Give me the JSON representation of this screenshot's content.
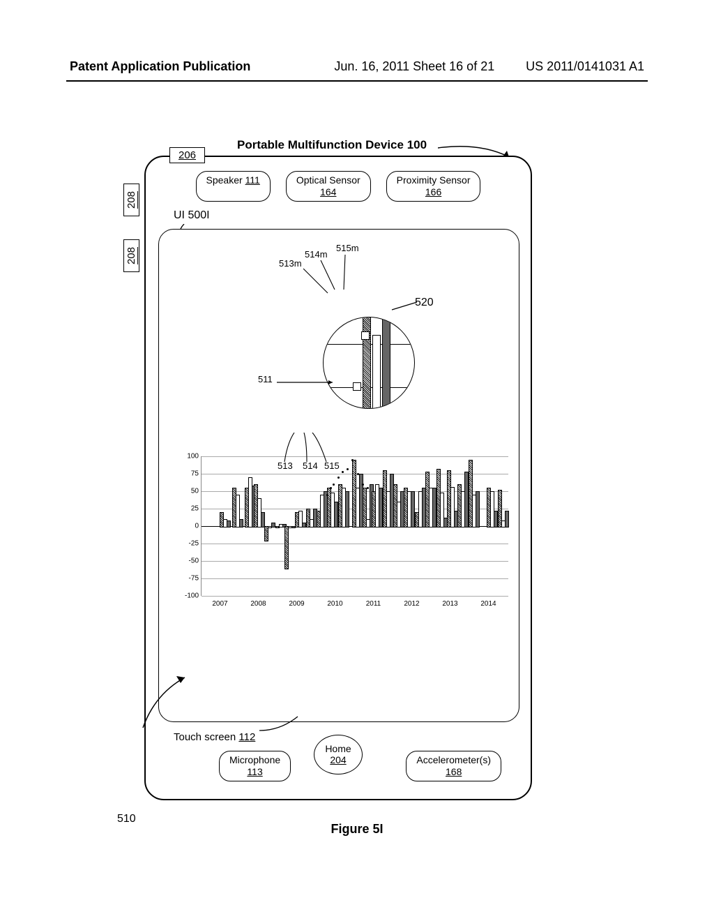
{
  "header": {
    "left": "Patent Application Publication",
    "middle": "Jun. 16, 2011  Sheet 16 of 21",
    "right": "US 2011/0141031 A1"
  },
  "device": {
    "title": "Portable Multifunction Device 100",
    "ref206": "206",
    "ref208a": "208",
    "ref208b": "208",
    "ui_label": "UI 500I",
    "sensors": {
      "speaker": {
        "label": "Speaker",
        "ref": "111"
      },
      "optical": {
        "label": "Optical Sensor",
        "ref": "164"
      },
      "proximity": {
        "label": "Proximity Sensor",
        "ref": "166"
      }
    },
    "bottom": {
      "touch": {
        "label": "Touch screen",
        "ref": "112"
      },
      "home": {
        "label": "Home",
        "ref": "204"
      },
      "mic": {
        "label": "Microphone",
        "ref": "113"
      },
      "accel": {
        "label": "Accelerometer(s)",
        "ref": "168"
      }
    }
  },
  "refs": {
    "r510": "510",
    "r520": "520",
    "r511": "511",
    "r513": "513",
    "r514": "514",
    "r515": "515",
    "r513m": "513m",
    "r514m": "514m",
    "r515m": "515m"
  },
  "figure": "Figure 5I",
  "chart_data": {
    "type": "bar",
    "ylim": [
      -100,
      100
    ],
    "y_ticks": [
      -100,
      -75,
      -50,
      -25,
      0,
      25,
      50,
      75,
      100
    ],
    "x_ticks": [
      "2007",
      "2008",
      "2009",
      "2010",
      "2011",
      "2012",
      "2013",
      "2014"
    ],
    "note": "Multi-series (3) grouped bar chart with a dotted line scatter overlay (511) and a magnified lens (520). Values are estimated from gridlines.",
    "series": [
      {
        "name": "513",
        "values_by_year_quarter": "approx 20–95 positive, a few negative down to ≈ -60 in 2008"
      },
      {
        "name": "514",
        "values_by_year_quarter": "approx 0–80, mostly positive"
      },
      {
        "name": "515",
        "values_by_year_quarter": "approx 5–85, all positive"
      }
    ],
    "bars": [
      {
        "x": 0.06,
        "s1": 20,
        "s2": 10,
        "s3": 8
      },
      {
        "x": 0.1,
        "s1": 55,
        "s2": 45,
        "s3": 10
      },
      {
        "x": 0.14,
        "s1": 55,
        "s2": 70,
        "s3": 58
      },
      {
        "x": 0.17,
        "s1": 60,
        "s2": 40,
        "s3": 20
      },
      {
        "x": 0.205,
        "s1": -20,
        "s2": 0,
        "s3": 5
      },
      {
        "x": 0.24,
        "s1": 0,
        "s2": 3,
        "s3": 3
      },
      {
        "x": 0.27,
        "s1": -60,
        "s2": 0,
        "s3": 0
      },
      {
        "x": 0.305,
        "s1": 20,
        "s2": 22,
        "s3": 5
      },
      {
        "x": 0.34,
        "s1": 25,
        "s2": 10,
        "s3": 25
      },
      {
        "x": 0.375,
        "s1": 22,
        "s2": 45,
        "s3": 50
      },
      {
        "x": 0.41,
        "s1": 55,
        "s2": 48,
        "s3": 35
      },
      {
        "x": 0.445,
        "s1": 60,
        "s2": 55,
        "s3": 50
      },
      {
        "x": 0.49,
        "s1": 95,
        "s2": 55,
        "s3": 75
      },
      {
        "x": 0.525,
        "s1": 55,
        "s2": 10,
        "s3": 60
      },
      {
        "x": 0.555,
        "s1": 50,
        "s2": 60,
        "s3": 55
      },
      {
        "x": 0.59,
        "s1": 80,
        "s2": 50,
        "s3": 75
      },
      {
        "x": 0.625,
        "s1": 60,
        "s2": 35,
        "s3": 50
      },
      {
        "x": 0.66,
        "s1": 55,
        "s2": 50,
        "s3": 50
      },
      {
        "x": 0.695,
        "s1": 20,
        "s2": 50,
        "s3": 55
      },
      {
        "x": 0.73,
        "s1": 78,
        "s2": 55,
        "s3": 55
      },
      {
        "x": 0.765,
        "s1": 82,
        "s2": 48,
        "s3": 12
      },
      {
        "x": 0.8,
        "s1": 80,
        "s2": 56,
        "s3": 22
      },
      {
        "x": 0.835,
        "s1": 60,
        "s2": 50,
        "s3": 78
      },
      {
        "x": 0.87,
        "s1": 95,
        "s2": 45,
        "s3": 50
      },
      {
        "x": 0.93,
        "s1": 55,
        "s2": 50,
        "s3": 22
      },
      {
        "x": 0.965,
        "s1": 52,
        "s2": 8,
        "s3": 22
      }
    ],
    "scatter_511": [
      {
        "x": 0.41,
        "y": 45
      },
      {
        "x": 0.42,
        "y": 55
      },
      {
        "x": 0.43,
        "y": 60
      },
      {
        "x": 0.445,
        "y": 70
      },
      {
        "x": 0.46,
        "y": 78
      },
      {
        "x": 0.475,
        "y": 82
      },
      {
        "x": 0.49,
        "y": 95
      },
      {
        "x": 0.51,
        "y": 75
      },
      {
        "x": 0.525,
        "y": 60
      },
      {
        "x": 0.54,
        "y": 55
      }
    ]
  }
}
